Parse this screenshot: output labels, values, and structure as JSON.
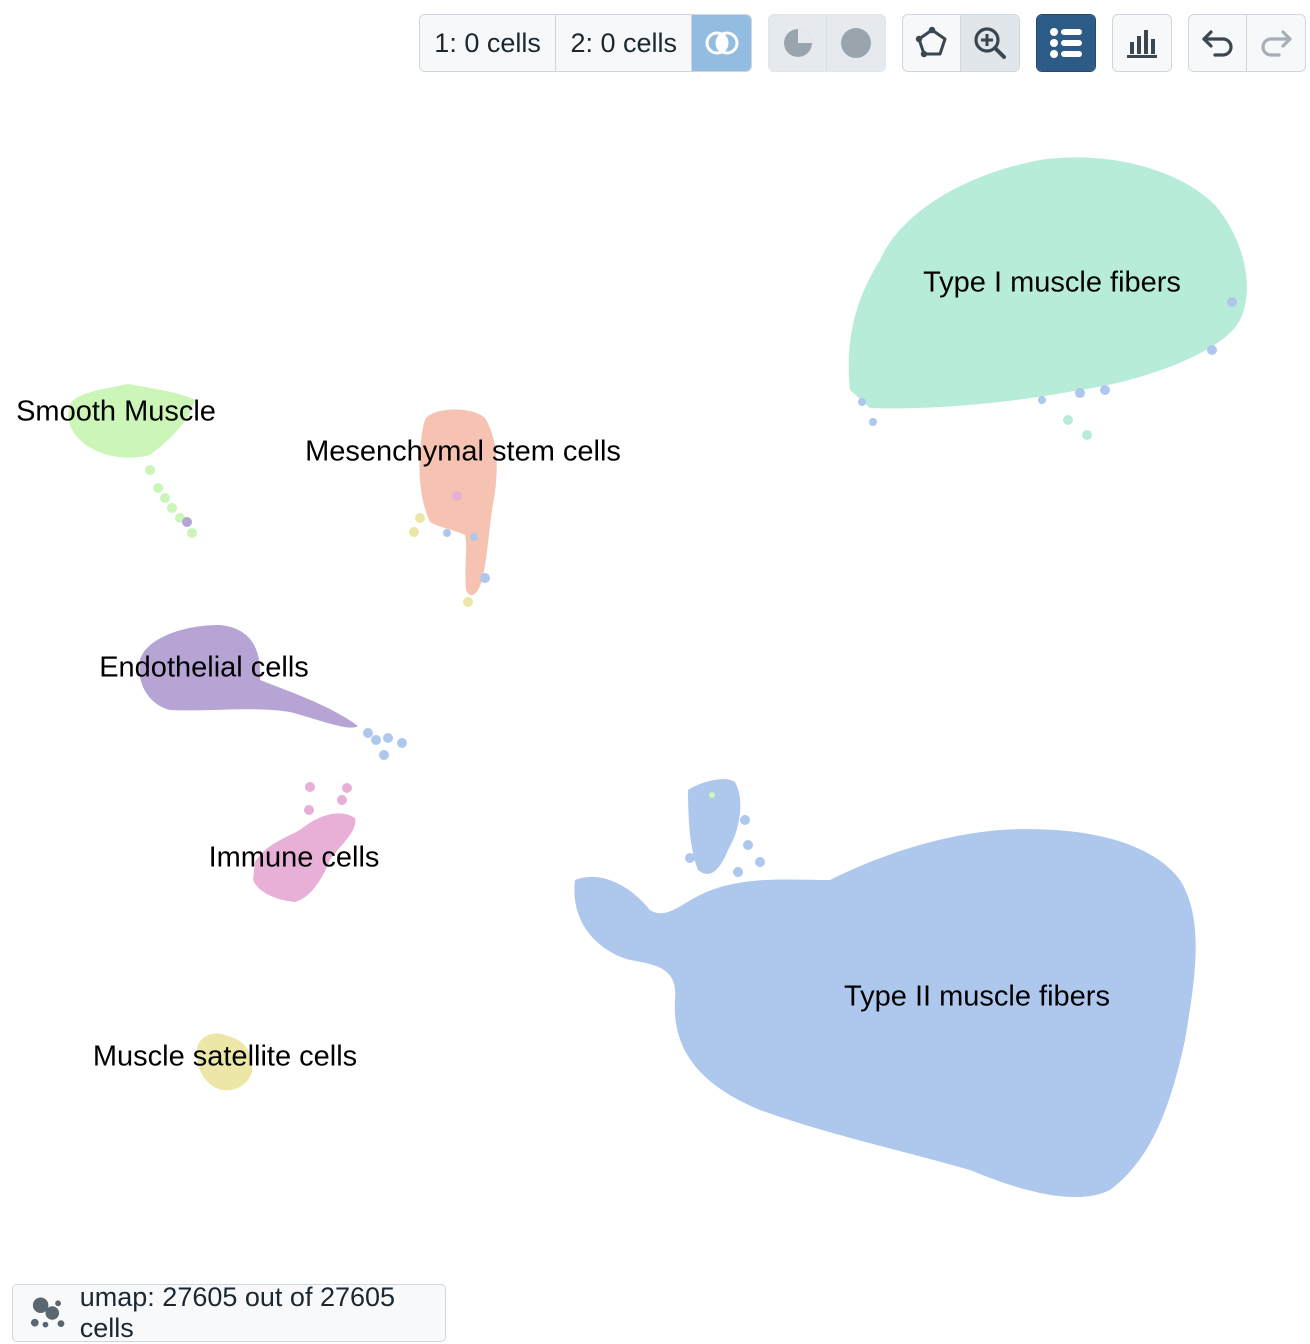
{
  "toolbar": {
    "selection1_label": "1: 0 cells",
    "selection2_label": "2: 0 cells",
    "icons": [
      "venn-icon",
      "pie-icon",
      "circle-icon",
      "lasso-icon",
      "zoom-icon",
      "list-icon",
      "bar-chart-icon",
      "undo-icon",
      "redo-icon"
    ]
  },
  "clusters": [
    {
      "id": "type1",
      "label": "Type I muscle fibers",
      "color": "#b7ecd8"
    },
    {
      "id": "smooth",
      "label": "Smooth Muscle",
      "color": "#ccf5b8"
    },
    {
      "id": "mesen",
      "label": "Mesenchymal stem cells",
      "color": "#f6c3b2"
    },
    {
      "id": "endo",
      "label": "Endothelial cells",
      "color": "#b6a4d5"
    },
    {
      "id": "immune",
      "label": "Immune cells",
      "color": "#e8b0d6"
    },
    {
      "id": "type2",
      "label": "Type II muscle fibers",
      "color": "#aec7ed"
    },
    {
      "id": "satellite",
      "label": "Muscle satellite cells",
      "color": "#ece7a6"
    }
  ],
  "footer": {
    "label": "umap: 27605 out of 27605 cells",
    "icon": "scatter-icon"
  }
}
